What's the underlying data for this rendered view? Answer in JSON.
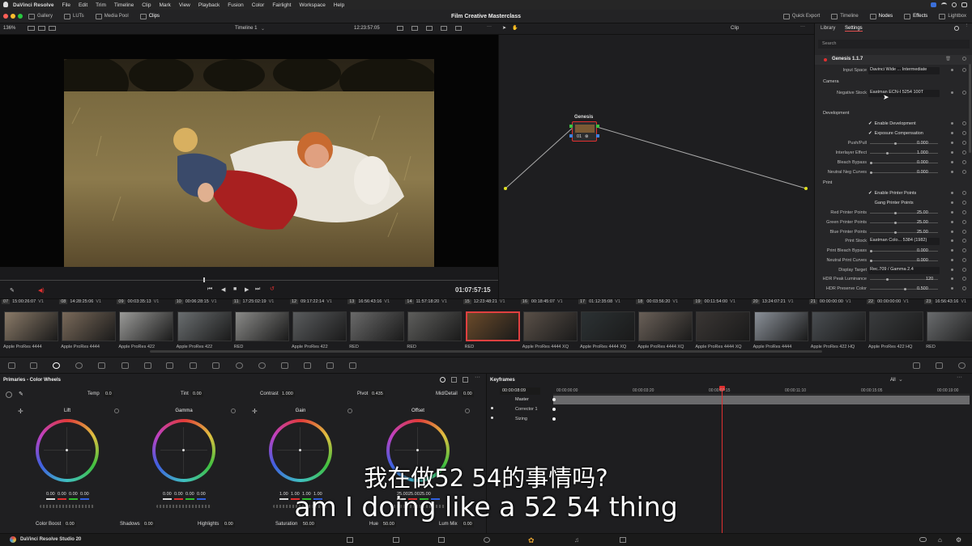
{
  "menubar": {
    "app": "DaVinci Resolve",
    "items": [
      "File",
      "Edit",
      "Trim",
      "Timeline",
      "Clip",
      "Mark",
      "View",
      "Playback",
      "Fusion",
      "Color",
      "Fairlight",
      "Workspace",
      "Help"
    ]
  },
  "toolbar": {
    "left": [
      "Gallery",
      "LUTs",
      "Media Pool",
      "Clips"
    ],
    "project_title": "Film Creative Masterclass",
    "right": [
      "Quick Export",
      "Timeline",
      "Nodes",
      "Effects",
      "Lightbox"
    ]
  },
  "viewer": {
    "zoom": "136%",
    "timeline_name": "Timeline 1",
    "timecode_top": "12:23:57:05",
    "clip_label": "Clip",
    "timecode": "01:07:57:15"
  },
  "settings_panel": {
    "tabs": [
      "Library",
      "Settings"
    ],
    "search_placeholder": "Search",
    "plugin_name": "Genesis 1.1.7",
    "input_space_label": "Input Space",
    "input_space_value": "Davinci Wide ... Intermediate",
    "section_camera": "Camera",
    "negative_stock_label": "Negative Stock",
    "negative_stock_value": "Eastman ECN-I 5254 100T",
    "section_development": "Development",
    "enable_development": "Enable Development",
    "exposure_compensation": "Exposure Compensation",
    "push_pull_label": "Push/Pull",
    "push_pull_value": "0.000",
    "interlayer_label": "Interlayer Effect",
    "interlayer_value": "1.000",
    "bleach_label": "Bleach Bypass",
    "bleach_value": "0.000",
    "neutral_neg_label": "Neutral Neg Curves",
    "neutral_neg_value": "0.000",
    "section_print": "Print",
    "enable_printer_points": "Enable Printer Points",
    "gang_printer_points": "Gang Printer Points",
    "red_pp_label": "Red Printer Points",
    "red_pp_value": "25.00",
    "green_pp_label": "Green Printer Points",
    "green_pp_value": "25.00",
    "blue_pp_label": "Blue Printer Points",
    "blue_pp_value": "25.00",
    "print_stock_label": "Print Stock",
    "print_stock_value": "Eastman Colo... 5384 (1982)",
    "print_bleach_label": "Print Bleach Bypass",
    "print_bleach_value": "0.000",
    "neutral_print_label": "Neutral Print Curves",
    "neutral_print_value": "0.000",
    "display_target_label": "Display Target",
    "display_target_value": "Rec.709 / Gamma 2.4",
    "hdr_peak_label": "HDR Peak Luminance",
    "hdr_peak_value": "120",
    "hdr_preserve_label": "HDR Preserve Color",
    "hdr_preserve_value": "0.500"
  },
  "node_graph": {
    "node_title": "Genesis",
    "node_label": "01"
  },
  "clips": [
    {
      "num": "07",
      "tc": "15:00:26:07",
      "codec": "Apple ProRes 4444",
      "color": "#8a7a68"
    },
    {
      "num": "08",
      "tc": "14:28:25:06",
      "codec": "Apple ProRes 4444",
      "color": "#7a6a5a"
    },
    {
      "num": "09",
      "tc": "00:03:35:13",
      "codec": "Apple ProRes 422",
      "color": "#9a9a98"
    },
    {
      "num": "10",
      "tc": "00:06:28:15",
      "codec": "Apple ProRes 422",
      "color": "#6a6e70"
    },
    {
      "num": "11",
      "tc": "17:25:02:19",
      "codec": "RED",
      "color": "#8a8a88"
    },
    {
      "num": "12",
      "tc": "09:17:22:14",
      "codec": "Apple ProRes 422",
      "color": "#5a5c5e"
    },
    {
      "num": "13",
      "tc": "16:56:43:16",
      "codec": "RED",
      "color": "#6a6a6a"
    },
    {
      "num": "14",
      "tc": "11:57:18:20",
      "codec": "RED",
      "color": "#5e5e5c"
    },
    {
      "num": "15",
      "tc": "12:23:48:21",
      "codec": "RED",
      "color": "#6a4a2a"
    },
    {
      "num": "16",
      "tc": "00:18:45:07",
      "codec": "Apple ProRes 4444 XQ",
      "color": "#5a5048"
    },
    {
      "num": "17",
      "tc": "01:12:35:08",
      "codec": "Apple ProRes 4444 XQ",
      "color": "#2c3234"
    },
    {
      "num": "18",
      "tc": "00:03:56:20",
      "codec": "Apple ProRes 4444 XQ",
      "color": "#6a6058"
    },
    {
      "num": "19",
      "tc": "00:11:54:00",
      "codec": "Apple ProRes 4444 XQ",
      "color": "#3a3634"
    },
    {
      "num": "20",
      "tc": "13:24:07:21",
      "codec": "Apple ProRes 4444",
      "color": "#8a9098"
    },
    {
      "num": "21",
      "tc": "00:00:00:00",
      "codec": "Apple ProRes 422 HQ",
      "color": "#4a4e52"
    },
    {
      "num": "22",
      "tc": "00:00:00:00",
      "codec": "Apple ProRes 422 HQ",
      "color": "#3a3c3e"
    },
    {
      "num": "23",
      "tc": "16:56:43:16",
      "codec": "RED",
      "color": "#6a6c6e"
    }
  ],
  "primaries": {
    "title": "Primaries - Color Wheels",
    "temp_label": "Temp",
    "temp_value": "0.0",
    "tint_label": "Tint",
    "tint_value": "0.00",
    "contrast_label": "Contrast",
    "contrast_value": "1.000",
    "pivot_label": "Pivot",
    "pivot_value": "0.435",
    "middetail_label": "Mid/Detail",
    "middetail_value": "0.00",
    "wheels": [
      {
        "name": "Lift",
        "values": [
          "0.00",
          "0.00",
          "0.00",
          "0.00"
        ]
      },
      {
        "name": "Gamma",
        "values": [
          "0.00",
          "0.00",
          "0.00",
          "0.00"
        ]
      },
      {
        "name": "Gain",
        "values": [
          "1.00",
          "1.00",
          "1.00",
          "1.00"
        ]
      },
      {
        "name": "Offset",
        "values": [
          "25.00",
          "25.00",
          "25.00",
          ""
        ]
      }
    ],
    "colorboost_label": "Color Boost",
    "colorboost_value": "0.00",
    "shadows_label": "Shadows",
    "shadows_value": "0.00",
    "highlights_label": "Highlights",
    "highlights_value": "0.00",
    "saturation_label": "Saturation",
    "saturation_value": "50.00",
    "hue_label": "Hue",
    "hue_value": "50.00",
    "lummix_label": "Lum Mix",
    "lummix_value": "0.00"
  },
  "keyframes": {
    "title": "Keyframes",
    "filter": "All",
    "timecode": "00:00:08:09",
    "ruler": [
      "00:00:00:00",
      "00:00:03:20",
      "00:00:07:15",
      "00:00:11:10",
      "00:00:15:05",
      "00:00:19:00"
    ],
    "tracks": [
      "Master",
      "Corrector 1",
      "Sizing"
    ]
  },
  "subtitles": {
    "line1": "我在做52 54的事情吗?",
    "line2": "am I doing like a 52 54 thing"
  },
  "bottom": {
    "app_version": "DaVinci Resolve Studio 20"
  }
}
